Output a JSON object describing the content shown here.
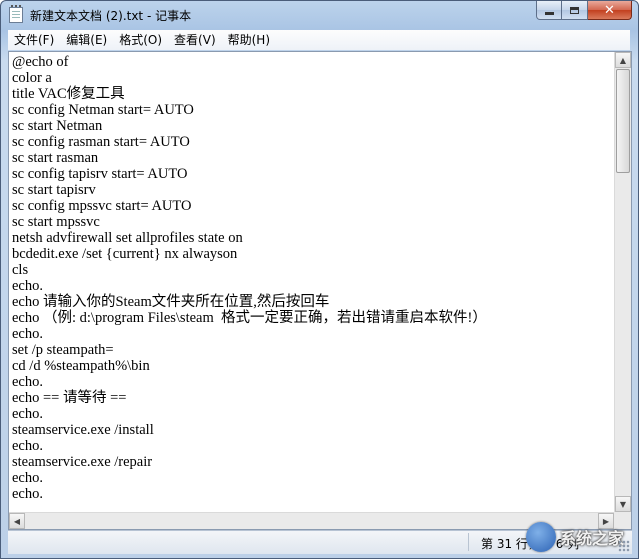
{
  "window": {
    "title": "新建文本文档 (2).txt - 记事本",
    "controls": {
      "minimize": "minimize",
      "maximize": "maximize",
      "close": "✕"
    }
  },
  "menu": {
    "items": [
      {
        "label": "文件(F)"
      },
      {
        "label": "编辑(E)"
      },
      {
        "label": "格式(O)"
      },
      {
        "label": "查看(V)"
      },
      {
        "label": "帮助(H)"
      }
    ]
  },
  "editor": {
    "lines": [
      "@echo of",
      "color a",
      "title VAC修复工具",
      "sc config Netman start= AUTO",
      "sc start Netman",
      "sc config rasman start= AUTO",
      "sc start rasman",
      "sc config tapisrv start= AUTO",
      "sc start tapisrv",
      "sc config mpssvc start= AUTO",
      "sc start mpssvc",
      "netsh advfirewall set allprofiles state on",
      "bcdedit.exe /set {current} nx alwayson",
      "cls",
      "echo.",
      "echo 请输入你的Steam文件夹所在位置,然后按回车",
      "echo （例: d:\\program Files\\steam  格式一定要正确，若出错请重启本软件!）",
      "echo.",
      "set /p steampath=",
      "cd /d %steampath%\\bin",
      "echo.",
      "echo == 请等待 ==",
      "echo.",
      "steamservice.exe /install",
      "echo.",
      "steamservice.exe /repair",
      "echo.",
      "echo."
    ]
  },
  "statusbar": {
    "position": "第 31 行，第 6 列"
  },
  "watermark": {
    "text": "系统之家"
  },
  "colors": {
    "frame": "#bcd3ec",
    "close_button": "#c2401f",
    "text": "#000000"
  }
}
